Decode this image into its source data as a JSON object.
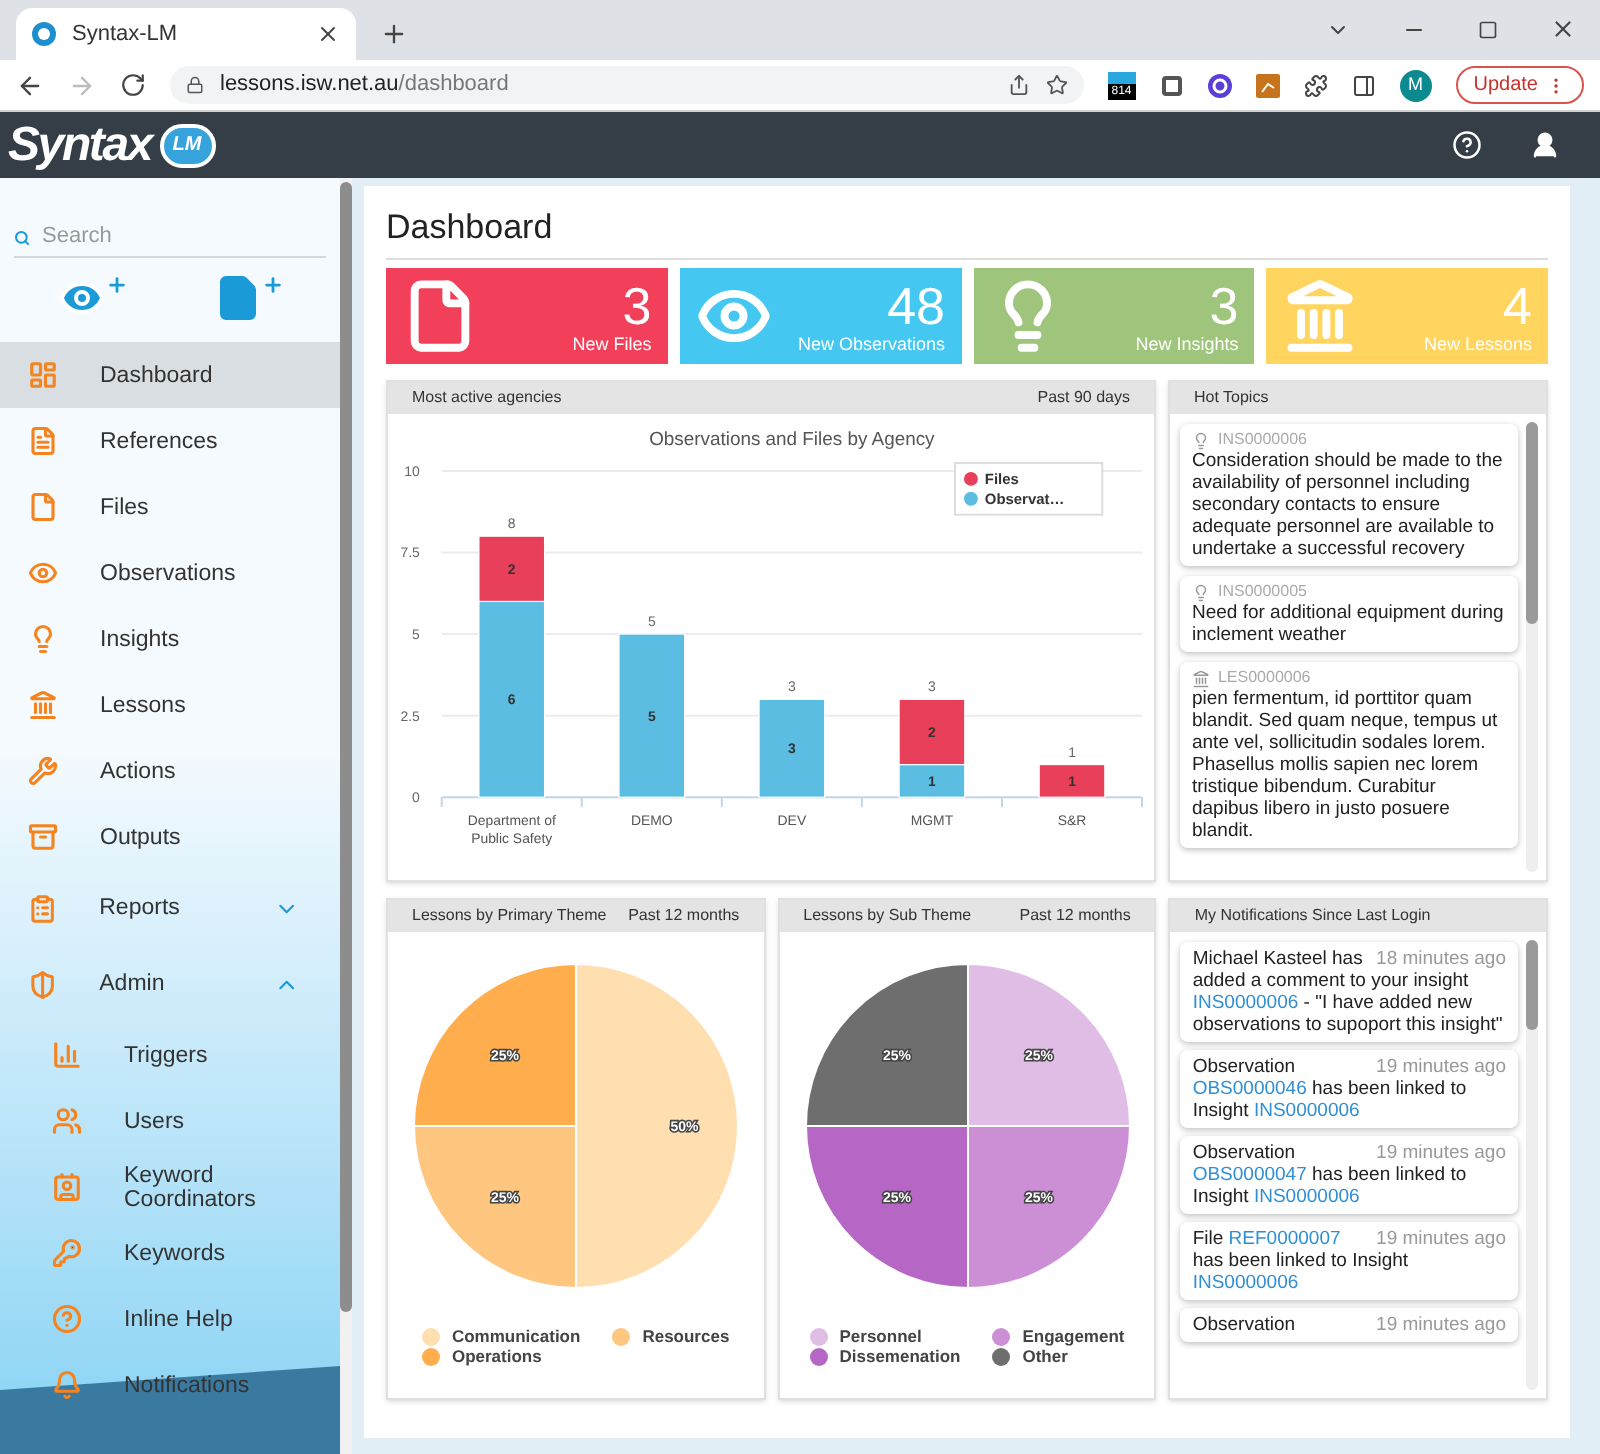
{
  "browser": {
    "tab_title": "Syntax-LM",
    "url_host": "lessons.isw.net.au",
    "url_path": "/dashboard",
    "extension_badge": "814",
    "profile_initial": "M",
    "update_button": "Update"
  },
  "header": {
    "logo_text": "Syntax",
    "logo_badge": "LM"
  },
  "sidebar": {
    "search": {
      "placeholder": "Search"
    },
    "items": [
      {
        "label": "Dashboard",
        "selected": true
      },
      {
        "label": "References",
        "selected": false
      },
      {
        "label": "Files",
        "selected": false
      },
      {
        "label": "Observations",
        "selected": false
      },
      {
        "label": "Insights",
        "selected": false
      },
      {
        "label": "Lessons",
        "selected": false
      },
      {
        "label": "Actions",
        "selected": false
      },
      {
        "label": "Outputs",
        "selected": false
      },
      {
        "label": "Reports",
        "selected": false,
        "expanded": false
      },
      {
        "label": "Admin",
        "selected": false,
        "expanded": true,
        "children": [
          {
            "label": "Triggers",
            "selected": false
          },
          {
            "label": "Users",
            "selected": false
          },
          {
            "label": "Keyword Coordinators",
            "selected": false
          },
          {
            "label": "Keywords",
            "selected": false
          },
          {
            "label": "Inline Help",
            "selected": false
          },
          {
            "label": "Notifications",
            "selected": false
          }
        ]
      }
    ]
  },
  "dashboard": {
    "title": "Dashboard",
    "stats": [
      {
        "value": "3",
        "label": "New Files",
        "color": "#f2405b"
      },
      {
        "value": "48",
        "label": "New Observations",
        "color": "#44c7f1"
      },
      {
        "value": "3",
        "label": "New Insights",
        "color": "#9fc57c"
      },
      {
        "value": "4",
        "label": "New Lessons",
        "color": "#ffd45f"
      }
    ],
    "agencies": {
      "title": "Most active agencies",
      "period": "Past 90 days",
      "chart_data": {
        "type": "bar",
        "title": "Observations and Files by Agency",
        "categories": [
          "Department of Public Safety",
          "DEMO",
          "DEV",
          "MGMT",
          "S&R"
        ],
        "stacked": true,
        "grid": true,
        "legend": true,
        "ylim": [
          0,
          10
        ],
        "yticks": [
          0,
          2.5,
          5,
          7.5,
          10
        ],
        "series": [
          {
            "name": "Files",
            "color": "#e8405b",
            "values": [
              2,
              0,
              0,
              2,
              1
            ],
            "value_labels": [
              "2",
              null,
              null,
              "2",
              "1"
            ]
          },
          {
            "name": "Observat…",
            "color": "#5cbde2",
            "values": [
              6,
              5,
              3,
              1,
              0
            ],
            "value_labels": [
              "6",
              "5",
              "3",
              "1",
              null
            ]
          }
        ],
        "annotations": [
          {
            "text": "8"
          },
          {
            "text": "5"
          },
          {
            "text": "3"
          },
          {
            "text": "3"
          },
          {
            "text": "1"
          }
        ]
      }
    },
    "hot_topics": {
      "title": "Hot Topics",
      "items": [
        {
          "kind": "insight",
          "ref": "INS0000006",
          "text": "Consideration should be made to the availability of personnel including secondary contacts to ensure adequate personnel are available to undertake a successful recovery"
        },
        {
          "kind": "insight",
          "ref": "INS0000005",
          "text": "Need for additional equipment during inclement weather"
        },
        {
          "kind": "lesson",
          "ref": "LES0000006",
          "text": "pien fermentum, id porttitor quam blandit. Sed quam neque, tempus ut ante vel, sollicitudin sodales lorem. Phasellus mollis sapien nec lorem tristique bibendum. Curabitur dapibus libero in justo posuere blandit."
        }
      ]
    },
    "theme_charts": [
      {
        "title": "Lessons by Primary Theme",
        "period": "Past 12 months",
        "chart_data": {
          "type": "pie",
          "categories": [
            "Communication",
            "Resources",
            "Operations"
          ],
          "values": [
            50,
            25,
            25
          ],
          "value_labels": [
            "50%",
            "25%",
            "25%"
          ],
          "colors": [
            "#ffdeb0",
            "#ffc680",
            "#ffad4d"
          ]
        }
      },
      {
        "title": "Lessons by Sub Theme",
        "period": "Past 12 months",
        "chart_data": {
          "type": "pie",
          "categories": [
            "Personnel",
            "Engagement",
            "Dissemenation",
            "Other"
          ],
          "values": [
            25,
            25,
            25,
            25
          ],
          "value_labels": [
            "25%",
            "25%",
            "25%",
            "25%"
          ],
          "colors": [
            "#e0bde5",
            "#cc8fd6",
            "#b666c4",
            "#6e6e6e"
          ]
        }
      }
    ],
    "notifications": {
      "title": "My Notifications Since Last Login",
      "items": [
        {
          "first_line": [
            {
              "text": "Michael Kasteel has",
              "link": false
            }
          ],
          "time": "18 minutes ago",
          "parts": [
            {
              "text": "added a comment to your insight ",
              "link": false
            },
            {
              "text": "INS0000006",
              "link": true
            },
            {
              "text": " - \"I have added new observations to supoport this insight\"",
              "link": false
            }
          ]
        },
        {
          "first_line": [
            {
              "text": "Observation",
              "link": false
            }
          ],
          "time": "19 minutes ago",
          "parts": [
            {
              "text": "OBS0000046",
              "link": true
            },
            {
              "text": " has been linked to Insight ",
              "link": false
            },
            {
              "text": "INS0000006",
              "link": true
            }
          ]
        },
        {
          "first_line": [
            {
              "text": "Observation",
              "link": false
            }
          ],
          "time": "19 minutes ago",
          "parts": [
            {
              "text": "OBS0000047",
              "link": true
            },
            {
              "text": " has been linked to Insight ",
              "link": false
            },
            {
              "text": "INS0000006",
              "link": true
            }
          ]
        },
        {
          "first_line": [
            {
              "text": "File ",
              "link": false
            },
            {
              "text": "REF0000007",
              "link": true
            }
          ],
          "time": "19 minutes ago",
          "parts": [
            {
              "text": "has been linked to Insight ",
              "link": false
            },
            {
              "text": "INS0000006",
              "link": true
            }
          ]
        },
        {
          "first_line": [
            {
              "text": "Observation",
              "link": false
            }
          ],
          "time": "19 minutes ago"
        }
      ]
    }
  }
}
